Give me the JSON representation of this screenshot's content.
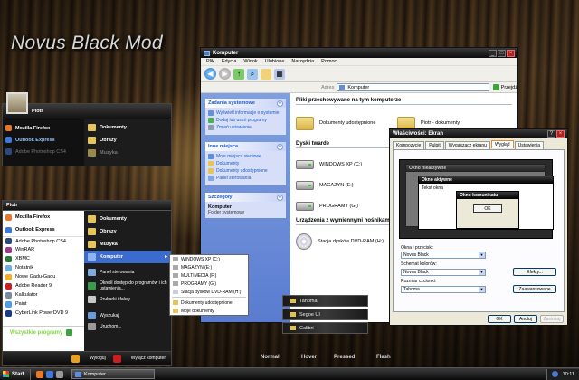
{
  "theme_title": "Novus Black Mod",
  "explorer": {
    "title": "Komputer",
    "menu": [
      "Plik",
      "Edycja",
      "Widok",
      "Ulubione",
      "Narzędzia",
      "Pomoc"
    ],
    "address_label": "Adres",
    "address_value": "Komputer",
    "go_label": "Przejdź",
    "task_panes": [
      {
        "title": "Zadania systemowe",
        "items": [
          "Wyświetl informacje o systemie",
          "Dodaj lub usuń programy",
          "Zmień ustawienie"
        ]
      },
      {
        "title": "Inne miejsca",
        "items": [
          "Moje miejsca sieciowe",
          "Dokumenty",
          "Dokumenty udostępnione",
          "Panel sterowania"
        ]
      }
    ],
    "details": {
      "title": "Szczegóły",
      "name": "Komputer",
      "subtitle": "Folder systemowy"
    },
    "sections": {
      "files_head": "Pliki przechowywane na tym komputerze",
      "files": [
        "Dokumenty udostępnione",
        "Piotr - dokumenty"
      ],
      "drives_head": "Dyski twarde",
      "drives": [
        "WINDOWS XP (C:)",
        "MAGAZYN (E:)",
        "PROGRAMY (G:)"
      ],
      "removable_head": "Urządzenia z wymiennymi nośnikami",
      "removable": [
        "Stacja dysków DVD-RAM (H:)"
      ]
    }
  },
  "dialog": {
    "title": "Właściwości: Ekran",
    "tabs": [
      "Kompozycje",
      "Pulpit",
      "Wygaszacz ekranu",
      "Wygląd",
      "Ustawienia"
    ],
    "active_tab_index": 3,
    "preview": {
      "inactive": "Okno nieaktywne",
      "active": "Okno aktywne",
      "text": "Tekst okna",
      "message": "Okno komunikatu",
      "ok": "OK"
    },
    "fields": [
      {
        "label": "Okna i przyciski:",
        "value": "Novus Black",
        "button": ""
      },
      {
        "label": "Schemat kolorów:",
        "value": "Novus Black",
        "button": "Efekty..."
      },
      {
        "label": "Rozmiar czcionki:",
        "value": "Tahoma",
        "button": "Zaawansowane"
      }
    ],
    "buttons": [
      "OK",
      "Anuluj",
      "Zastosuj"
    ]
  },
  "start_menu_top": {
    "user": "Piotr",
    "left": [
      "Mozilla Firefox",
      "Outlook Express",
      "Adobe Photoshop CS4"
    ],
    "right": [
      "Dokumenty",
      "Obrazy",
      "Muzyka"
    ]
  },
  "start_menu": {
    "user": "Piotr",
    "left": [
      "Mozilla Firefox",
      "Outlook Express",
      "Adobe Photoshop CS4",
      "WinRAR",
      "XBMC",
      "Notatnik",
      "Nowe Gadu-Gadu",
      "Adobe Reader 9",
      "Kalkulator",
      "Paint",
      "CyberLink PowerDVD 9"
    ],
    "all_programs": "Wszystkie programy",
    "right": [
      "Dokumenty",
      "Obrazy",
      "Muzyka",
      "Komputer",
      "Panel sterowania",
      "Określ dostęp do programów i ich ustawienia...",
      "Drukarki i faksy",
      "Wyszukaj",
      "Uruchom..."
    ],
    "logoff": "Wyloguj",
    "shutdown": "Wyłącz komputer"
  },
  "computer_submenu": [
    "WINDOWS XP (C:)",
    "MAGAZYN (E:)",
    "MULTIMEDIA (F:)",
    "PROGRAMY (G:)",
    "Stacja dysków DVD-RAM (H:)",
    "Dokumenty udostępnione",
    "Moje dokumenty"
  ],
  "font_menu": [
    "Tahoma",
    "Segoe UI",
    "Calibri"
  ],
  "button_states": [
    "Normal",
    "Hover",
    "Pressed",
    "Flash"
  ],
  "taskbar": {
    "start": "Start",
    "task": "Komputer",
    "clock": "10:11"
  }
}
